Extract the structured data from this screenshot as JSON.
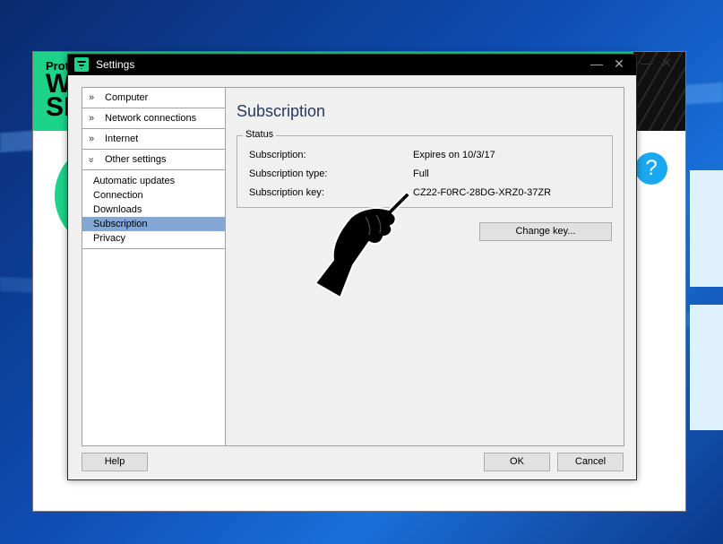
{
  "dialog": {
    "title": "Settings",
    "categories": [
      {
        "label": "Computer",
        "expanded": false
      },
      {
        "label": "Network connections",
        "expanded": false
      },
      {
        "label": "Internet",
        "expanded": false
      },
      {
        "label": "Other settings",
        "expanded": true
      }
    ],
    "sub_items": [
      "Automatic updates",
      "Connection",
      "Downloads",
      "Subscription",
      "Privacy"
    ],
    "selected_sub_item": "Subscription",
    "content": {
      "heading": "Subscription",
      "group_title": "Status",
      "rows": [
        {
          "label": "Subscription:",
          "value": "Expires on 10/3/17"
        },
        {
          "label": "Subscription type:",
          "value": "Full"
        },
        {
          "label": "Subscription key:",
          "value": "CZ22-F0RC-28DG-XRZ0-37ZR"
        }
      ],
      "change_key_label": "Change key..."
    },
    "buttons": {
      "help": "Help",
      "ok": "OK",
      "cancel": "Cancel"
    }
  },
  "background_app": {
    "brand_small": "Prot",
    "brand_line1": "W",
    "brand_line2": "SE",
    "help_glyph": "?"
  },
  "colors": {
    "accent_green": "#1dd38a",
    "selection": "#84a6d2",
    "help_blue": "#1aa9f0"
  },
  "icons": {
    "expand": "double-chevron-right-icon",
    "collapse": "double-chevron-down-icon",
    "minimize": "minimize-icon",
    "close": "close-icon"
  }
}
